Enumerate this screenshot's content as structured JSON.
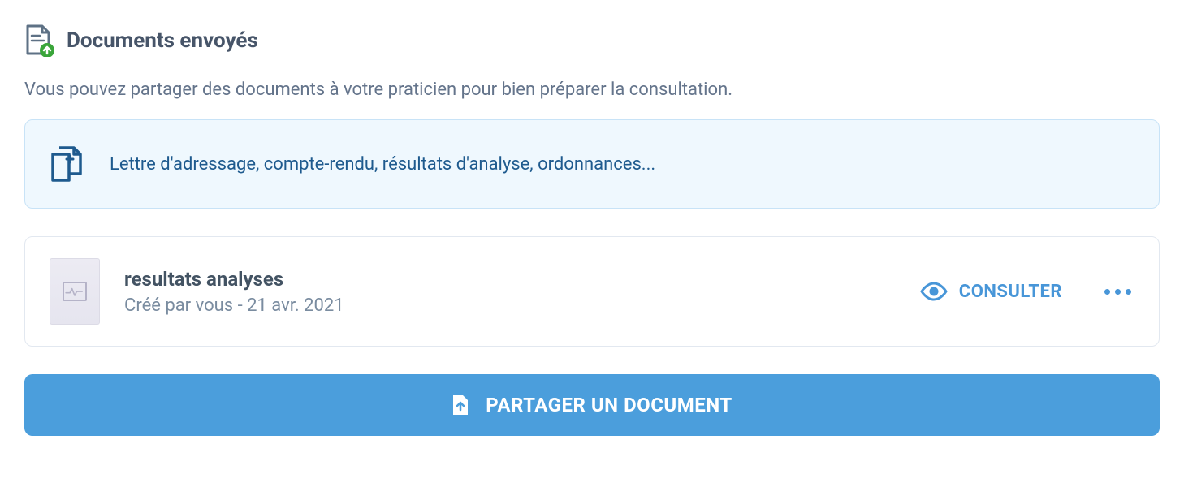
{
  "header": {
    "title": "Documents envoyés"
  },
  "description": "Vous pouvez partager des documents à votre praticien pour bien préparer la consultation.",
  "info_banner": {
    "text": "Lettre d'adressage, compte-rendu, résultats d'analyse, ordonnances..."
  },
  "documents": [
    {
      "name": "resultats analyses",
      "meta": "Créé par vous - 21 avr. 2021",
      "view_label": "CONSULTER"
    }
  ],
  "share_button": {
    "label": "PARTAGER UN DOCUMENT"
  }
}
